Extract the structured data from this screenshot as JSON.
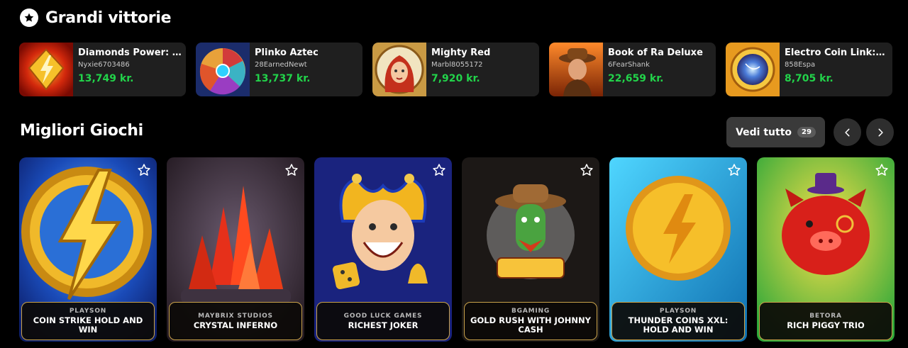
{
  "big_wins": {
    "title": "Grandi vittorie",
    "items": [
      {
        "game": "Diamonds Power: H...",
        "user": "Nyxie6703486",
        "amount": "13,749 kr."
      },
      {
        "game": "Plinko Aztec",
        "user": "28EarnedNewt",
        "amount": "13,737 kr."
      },
      {
        "game": "Mighty Red",
        "user": "Marbl8055172",
        "amount": "7,920 kr."
      },
      {
        "game": "Book of Ra Deluxe",
        "user": "6FearShank",
        "amount": "22,659 kr."
      },
      {
        "game": "Electro Coin Link: R...",
        "user": "858Espa",
        "amount": "8,705 kr."
      }
    ]
  },
  "top_games": {
    "title": "Migliori Giochi",
    "view_all_label": "Vedi tutto",
    "view_all_count": "29",
    "items": [
      {
        "provider": "PLAYSON",
        "title": "COIN STRIKE HOLD AND WIN"
      },
      {
        "provider": "MAYBRIX STUDIOS",
        "title": "CRYSTAL INFERNO"
      },
      {
        "provider": "GOOD LUCK GAMES",
        "title": "RICHEST JOKER"
      },
      {
        "provider": "BGAMING",
        "title": "GOLD RUSH WITH JOHNNY CASH"
      },
      {
        "provider": "PLAYSON",
        "title": "THUNDER COINS XXL: HOLD AND WIN"
      },
      {
        "provider": "BETORA",
        "title": "RICH PIGGY TRIO"
      }
    ]
  },
  "icons": {
    "section_star": "star-icon",
    "favorite": "star-outline-icon",
    "prev": "chevron-left-icon",
    "next": "chevron-right-icon"
  },
  "colors": {
    "win_amount": "#22d34a",
    "label_border": "#c9a24a",
    "card_bg": "#1f1f1f"
  }
}
